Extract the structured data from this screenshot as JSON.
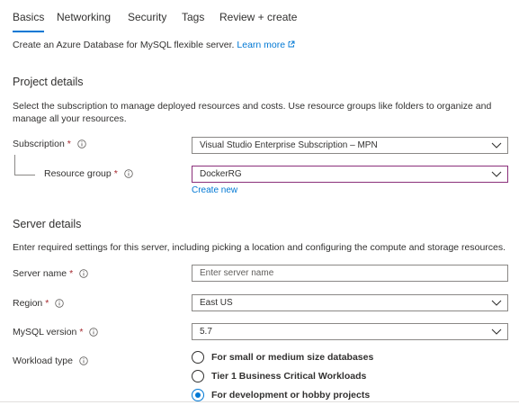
{
  "tabs": [
    {
      "label": "Basics",
      "active": true
    },
    {
      "label": "Networking",
      "active": false
    },
    {
      "label": "Security",
      "active": false
    },
    {
      "label": "Tags",
      "active": false
    },
    {
      "label": "Review + create",
      "active": false
    }
  ],
  "intro": {
    "text": "Create an Azure Database for MySQL flexible server.",
    "link_label": "Learn more"
  },
  "project": {
    "heading": "Project details",
    "description": "Select the subscription to manage deployed resources and costs. Use resource groups like folders to organize and manage all your resources.",
    "subscription_label": "Subscription",
    "subscription_value": "Visual Studio Enterprise Subscription – MPN",
    "resource_group_label": "Resource group",
    "resource_group_value": "DockerRG",
    "create_new_label": "Create new"
  },
  "server": {
    "heading": "Server details",
    "description": "Enter required settings for this server, including picking a location and configuring the compute and storage resources.",
    "name_label": "Server name",
    "name_placeholder": "Enter server name",
    "name_value": "",
    "region_label": "Region",
    "region_value": "East US",
    "version_label": "MySQL version",
    "version_value": "5.7",
    "workload_label": "Workload type",
    "workload_options": [
      {
        "label": "For small or medium size databases",
        "selected": false
      },
      {
        "label": "Tier 1 Business Critical Workloads",
        "selected": false
      },
      {
        "label": "For development or hobby projects",
        "selected": true
      }
    ]
  },
  "required_marker": "*",
  "colors": {
    "accent": "#0078d4",
    "required": "#a4262c",
    "focus_border": "#8a2f7a"
  }
}
